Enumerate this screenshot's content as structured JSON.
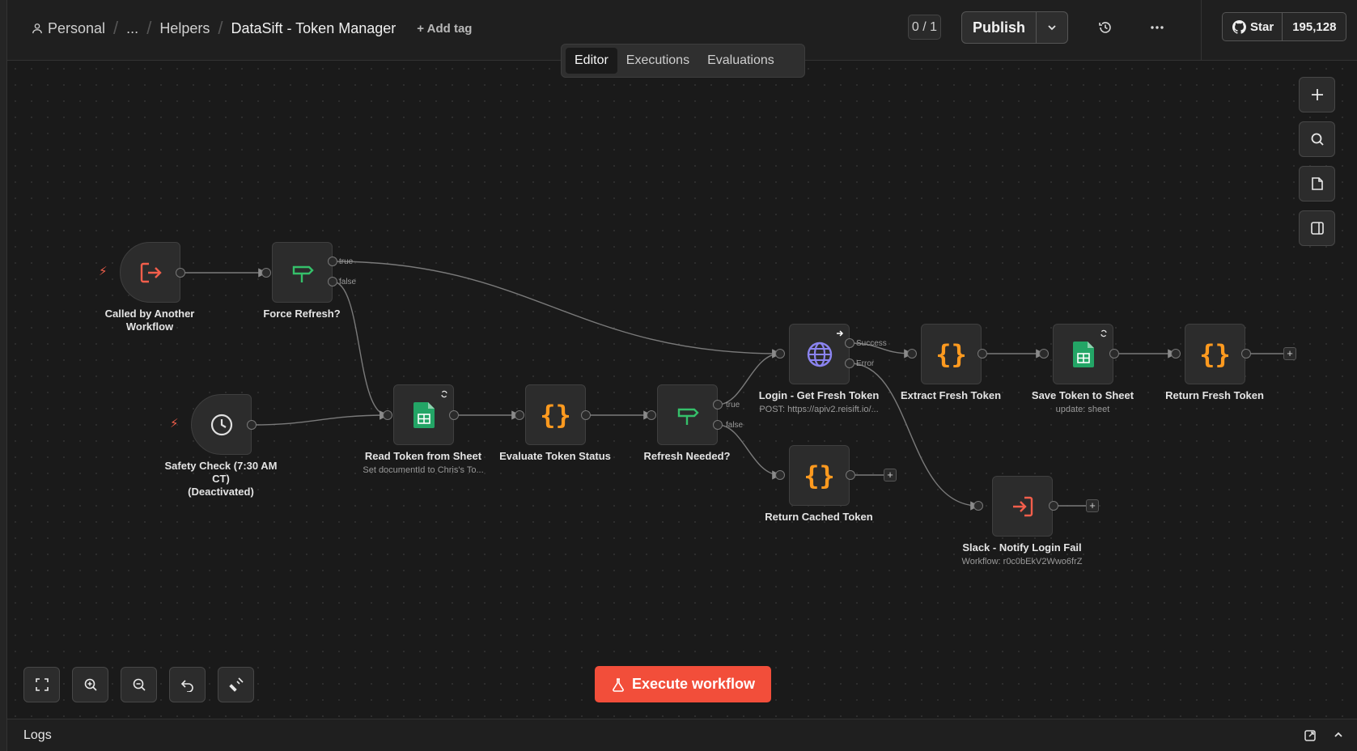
{
  "breadcrumb": {
    "personal": "Personal",
    "ellipsis": "...",
    "helpers": "Helpers",
    "workflow_name": "DataSift - Token Manager",
    "add_tag": "+ Add tag"
  },
  "header": {
    "counter": "0 / 1",
    "publish_label": "Publish",
    "star_label": "Star",
    "star_count": "195,128"
  },
  "tabs": [
    "Editor",
    "Executions",
    "Evaluations"
  ],
  "active_tab": "Editor",
  "nodes": {
    "called_by_another": {
      "label": "Called by Another Workflow"
    },
    "force_refresh": {
      "label": "Force Refresh?",
      "out_true": "true",
      "out_false": "false"
    },
    "safety_check": {
      "label": "Safety Check (7:30 AM CT)",
      "label2": "(Deactivated)"
    },
    "read_token": {
      "label": "Read Token from Sheet",
      "sub": "Set documentId to Chris's To..."
    },
    "evaluate_status": {
      "label": "Evaluate Token Status"
    },
    "refresh_needed": {
      "label": "Refresh Needed?",
      "out_true": "true",
      "out_false": "false"
    },
    "login": {
      "label": "Login - Get Fresh Token",
      "sub": "POST: https://apiv2.reisift.io/...",
      "out_success": "Success",
      "out_error": "Error"
    },
    "extract": {
      "label": "Extract Fresh Token"
    },
    "save": {
      "label": "Save Token to Sheet",
      "sub": "update: sheet"
    },
    "return_fresh": {
      "label": "Return Fresh Token"
    },
    "return_cached": {
      "label": "Return Cached Token"
    },
    "slack": {
      "label": "Slack - Notify Login Fail",
      "sub": "Workflow: r0c0bEkV2Wwo6frZ"
    }
  },
  "execute_label": "Execute workflow",
  "logs_label": "Logs",
  "colors": {
    "accent": "#f24e3a",
    "code": "#ff9a1f",
    "if": "#35c06a",
    "sheets": "#23a566",
    "http": "#8b84f0",
    "trigger": "#f25e4b"
  }
}
